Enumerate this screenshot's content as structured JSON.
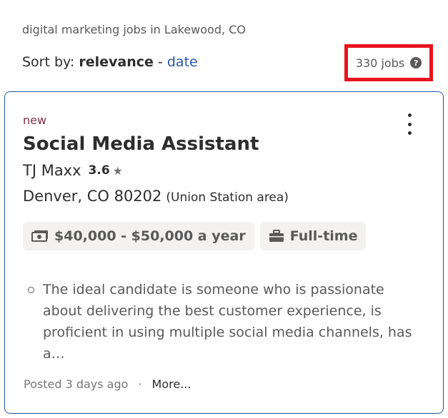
{
  "search": {
    "query_summary": "digital marketing jobs in Lakewood, CO"
  },
  "sort": {
    "prefix": "Sort by:",
    "active": "relevance",
    "separator": "-",
    "alternate": "date"
  },
  "results": {
    "count_label": "330 jobs",
    "help_glyph": "?"
  },
  "job": {
    "badge": "new",
    "title": "Social Media Assistant",
    "company": "TJ Maxx",
    "rating": "3.6",
    "location": "Denver, CO 80202",
    "location_area": "(Union Station area)",
    "salary": "$40,000 - $50,000 a year",
    "job_type": "Full-time",
    "snippet": "The ideal candidate is someone who is passionate about delivering the best customer experience, is proficient in using multiple social media channels, has a…",
    "posted": "Posted 3 days ago",
    "more_label": "More..."
  },
  "colors": {
    "highlight_box": "#e8141e",
    "link": "#2557a7",
    "new_badge": "#7d2f4d",
    "card_border": "#2557a7"
  },
  "icons": {
    "salary": "money-icon",
    "job_type": "briefcase-icon",
    "rating": "star-icon",
    "menu": "kebab-menu-icon",
    "help": "help-circle-icon"
  }
}
